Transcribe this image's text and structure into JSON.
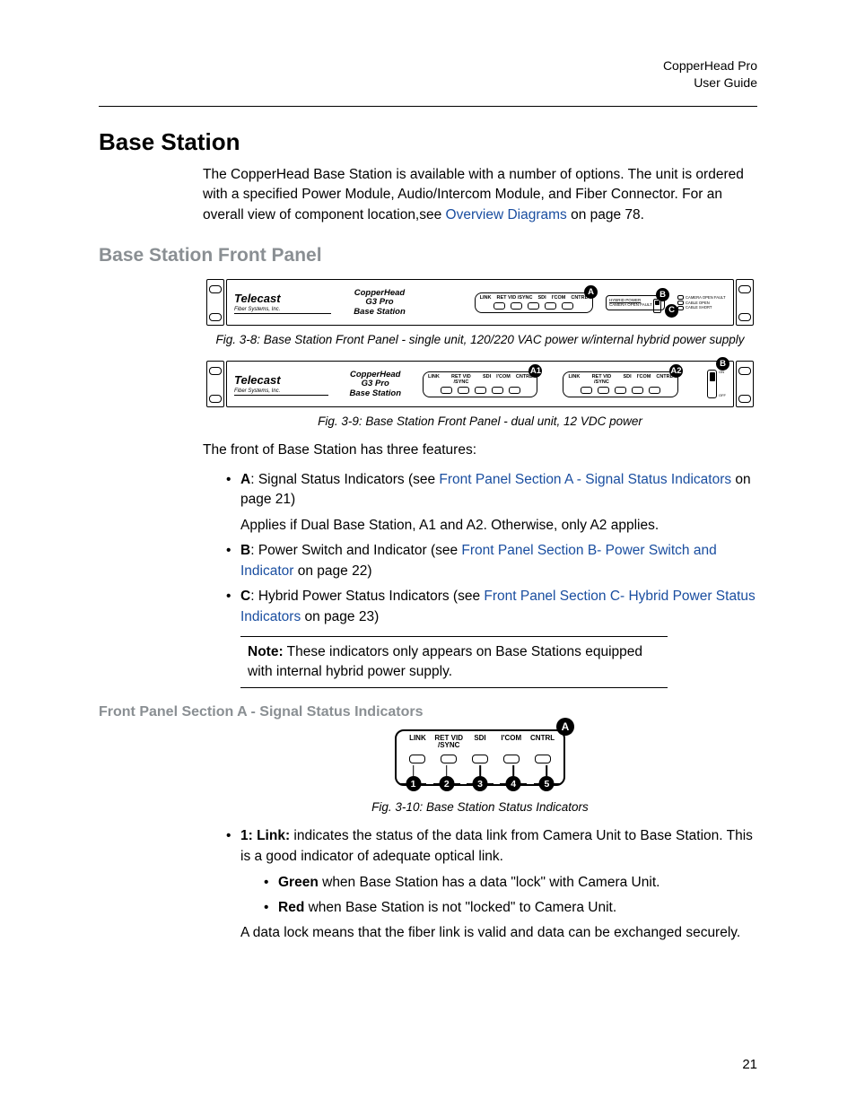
{
  "header": {
    "product": "CopperHead Pro",
    "sub": "User Guide"
  },
  "h1": "Base Station",
  "intro": {
    "p1a": "The CopperHead Base Station is available with a number of options. The unit is ordered with a specified Power Module, Audio/Intercom Module, and Fiber Connector. For an overall view of component location,see ",
    "link": "Overview Diagrams",
    "p1b": " on page 78."
  },
  "h2": "Base Station Front Panel",
  "fig": {
    "brand": "Telecast",
    "brand_sub": "Fiber Systems, Inc.",
    "model1": "CopperHead",
    "model2": "G3 Pro",
    "model3": "Base Station",
    "led_labels": [
      "LINK",
      "RET VID /SYNC",
      "SDI",
      "I'COM",
      "CNTRL"
    ],
    "power_title": "HYBRID POWER",
    "pw1": "CAMERA OPEN FAULT",
    "pw2": "CABLE OPEN",
    "pw3": "CABLE SHORT",
    "sw_on": "ON",
    "sw_off": "OFF",
    "A": "A",
    "A1": "A1",
    "A2": "A2",
    "B": "B",
    "C": "C"
  },
  "cap1": "Fig. 3-8: Base Station Front Panel - single unit, 120/220 VAC power w/internal hybrid power supply",
  "cap2": "Fig. 3-9: Base Station Front Panel - dual unit, 12 VDC power",
  "features_intro": "The front of Base Station has three features:",
  "featA": {
    "lead": "A",
    "txt1": ": Signal Status Indicators (see ",
    "link": "Front Panel Section A - Signal Status Indicators",
    "txt2": " on page 21)",
    "applies": "Applies if Dual Base Station, A1 and A2.  Otherwise, only A2 applies."
  },
  "featB": {
    "lead": "B",
    "txt1": ": Power Switch and Indicator (see ",
    "link": "Front Panel Section B- Power Switch and Indicator",
    "txt2": " on page 22)"
  },
  "featC": {
    "lead": "C",
    "txt1": ": Hybrid Power Status Indicators (see ",
    "link": "Front Panel Section C- Hybrid Power Status Indicators",
    "txt2": " on page 23)"
  },
  "note": {
    "lead": "Note:",
    "body": "  These indicators  only appears on Base Stations equipped with internal hybrid power supply."
  },
  "h3": "Front Panel Section A - Signal Status Indicators",
  "statfig": {
    "labels": [
      "LINK",
      "RET VID /SYNC",
      "SDI",
      "I'COM",
      "CNTRL"
    ],
    "A": "A",
    "nums": [
      "1",
      "2",
      "3",
      "4",
      "5"
    ]
  },
  "cap3": "Fig. 3-10: Base Station Status Indicators",
  "link_item": {
    "lead": "1: Link:",
    "body": " indicates the status of the data link from Camera Unit to Base Station. This is a good indicator of adequate optical link.",
    "g_lead": "Green",
    "g_body": " when Base Station has a data \"lock\" with Camera Unit.",
    "r_lead": "Red",
    "r_body": " when Base Station is not \"locked\" to Camera Unit.",
    "closing": "A data lock means that the fiber link is valid and data can be exchanged securely."
  },
  "page_num": "21"
}
